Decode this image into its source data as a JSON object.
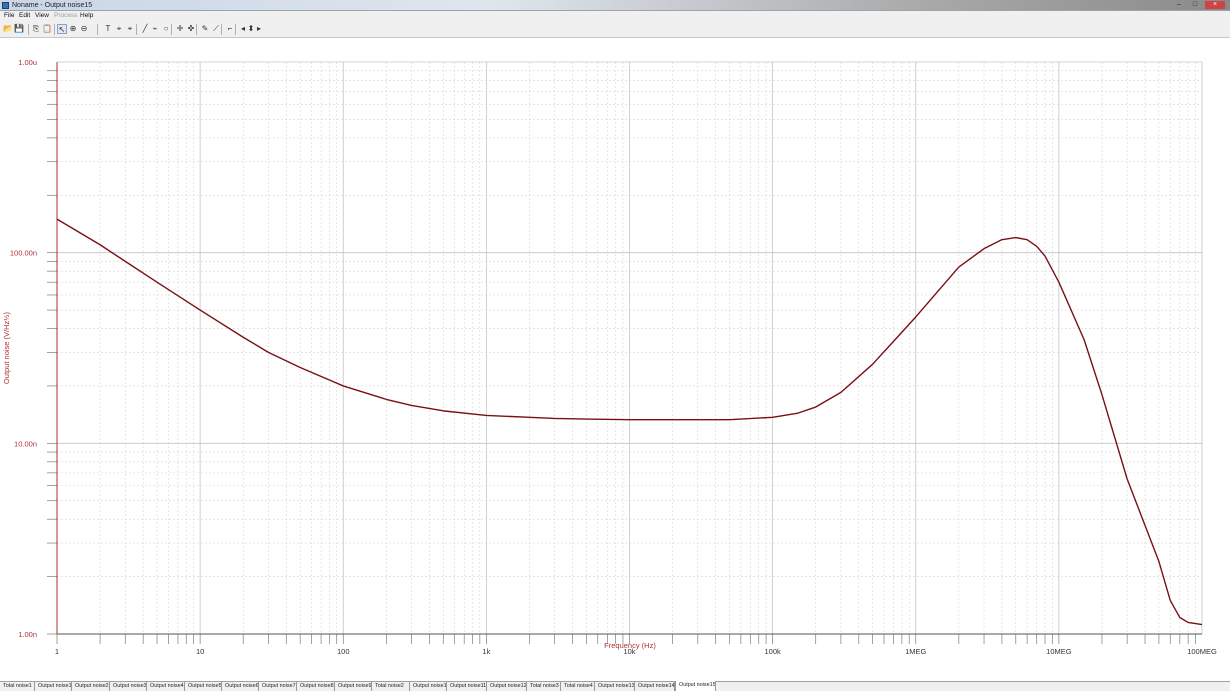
{
  "window": {
    "title": "Noname - Output noise15",
    "minimize_label": "–",
    "maximize_label": "□",
    "close_label": "×"
  },
  "menu": {
    "items": [
      {
        "label": "File",
        "enabled": true
      },
      {
        "label": "Edit",
        "enabled": true
      },
      {
        "label": "View",
        "enabled": true
      },
      {
        "label": "Process",
        "enabled": false
      },
      {
        "label": "Help",
        "enabled": true
      }
    ]
  },
  "toolbar": {
    "buttons": [
      {
        "name": "open-icon",
        "glyph": "📂"
      },
      {
        "name": "save-icon",
        "glyph": "💾"
      },
      {
        "name": "copy-icon",
        "glyph": "⎘"
      },
      {
        "name": "paste-icon",
        "glyph": "📋"
      },
      {
        "name": "pointer-icon",
        "glyph": "↖",
        "pressed": true
      },
      {
        "name": "zoom-in-icon",
        "glyph": "⊕"
      },
      {
        "name": "zoom-out-icon",
        "glyph": "⊖"
      },
      {
        "name": "text-icon",
        "glyph": "T"
      },
      {
        "name": "cursor-a-icon",
        "glyph": "⌖"
      },
      {
        "name": "cursor-b-icon",
        "glyph": "⌖"
      },
      {
        "name": "line-icon",
        "glyph": "╱"
      },
      {
        "name": "arrow-icon",
        "glyph": "⌁"
      },
      {
        "name": "ellipse-icon",
        "glyph": "○"
      },
      {
        "name": "crosshair-a-icon",
        "glyph": "✛"
      },
      {
        "name": "crosshair-b-icon",
        "glyph": "✜"
      },
      {
        "name": "marker-icon",
        "glyph": "✎"
      },
      {
        "name": "tangent-icon",
        "glyph": "⟋"
      },
      {
        "name": "label-icon",
        "glyph": "⌐"
      },
      {
        "name": "pan-left-icon",
        "glyph": "◂"
      },
      {
        "name": "pan-updown-icon",
        "glyph": "⬍"
      },
      {
        "name": "pan-right-icon",
        "glyph": "▸"
      }
    ]
  },
  "chart_data": {
    "type": "line",
    "title": "",
    "xlabel": "Frequency (Hz)",
    "ylabel": "Output noise (V/Hz½)",
    "x_scale": "log",
    "y_scale": "log",
    "xlim": [
      1,
      100000000
    ],
    "ylim": [
      1e-09,
      1e-06
    ],
    "grid": true,
    "x_tick_labels": [
      "1",
      "10",
      "100",
      "1k",
      "10k",
      "100k",
      "1MEG",
      "10MEG",
      "100MEG"
    ],
    "y_tick_labels": [
      "1.00u",
      "100.00n",
      "10.00n",
      "1.00n"
    ],
    "line_color": "#7a1016",
    "axis_color": "#b03030",
    "series": [
      {
        "x": [
          1,
          2,
          3,
          5,
          10,
          20,
          30,
          50,
          100,
          200,
          300,
          500,
          1000,
          2000,
          3000,
          5000,
          10000,
          20000,
          30000,
          50000,
          100000,
          150000,
          200000,
          300000,
          500000,
          1000000,
          2000000,
          3000000,
          4000000,
          5000000,
          6000000,
          7000000,
          8000000,
          10000000,
          15000000,
          20000000,
          30000000,
          50000000,
          60000000,
          70000000,
          80000000,
          100000000
        ],
        "y": [
          1.5e-07,
          1.1e-07,
          9e-08,
          7e-08,
          5e-08,
          3.6e-08,
          3e-08,
          2.5e-08,
          2e-08,
          1.7e-08,
          1.58e-08,
          1.48e-08,
          1.4e-08,
          1.37e-08,
          1.35e-08,
          1.34e-08,
          1.33e-08,
          1.33e-08,
          1.33e-08,
          1.33e-08,
          1.37e-08,
          1.44e-08,
          1.55e-08,
          1.85e-08,
          2.6e-08,
          4.6e-08,
          8.4e-08,
          1.05e-07,
          1.17e-07,
          1.2e-07,
          1.17e-07,
          1.08e-07,
          9.6e-08,
          7e-08,
          3.5e-08,
          1.8e-08,
          6.5e-09,
          2.4e-09,
          1.5e-09,
          1.22e-09,
          1.15e-09,
          1.12e-09
        ]
      }
    ]
  },
  "tabs": {
    "items": [
      {
        "label": "Total noise1"
      },
      {
        "label": "Output noise1"
      },
      {
        "label": "Output noise2"
      },
      {
        "label": "Output noise3"
      },
      {
        "label": "Output noise4"
      },
      {
        "label": "Output noise5"
      },
      {
        "label": "Output noise6"
      },
      {
        "label": "Output noise7"
      },
      {
        "label": "Output noise8"
      },
      {
        "label": "Output noise9"
      },
      {
        "label": "Total noise2"
      },
      {
        "label": "Output noise10"
      },
      {
        "label": "Output noise11"
      },
      {
        "label": "Output noise12"
      },
      {
        "label": "Total noise3"
      },
      {
        "label": "Total noise4"
      },
      {
        "label": "Output noise13"
      },
      {
        "label": "Output noise14"
      },
      {
        "label": "Output noise15",
        "active": true
      }
    ]
  }
}
